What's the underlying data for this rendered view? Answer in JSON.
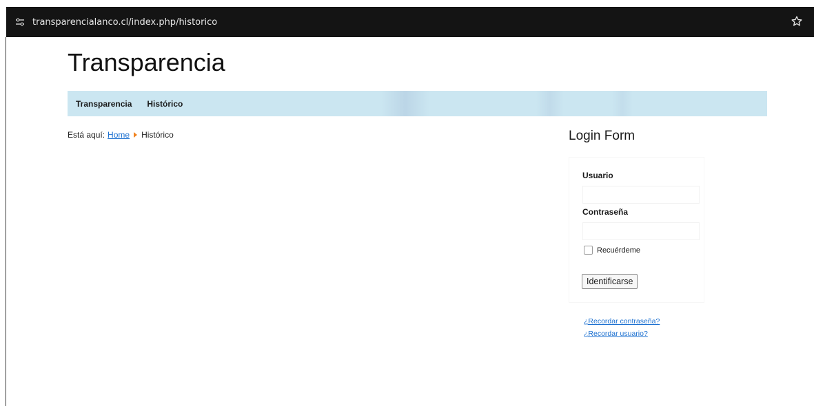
{
  "browser": {
    "url": "transparencialanco.cl/index.php/historico",
    "site_info_icon": "tune-icon",
    "bookmark_icon": "star-outline-icon"
  },
  "site": {
    "title": "Transparencia"
  },
  "nav": {
    "items": [
      {
        "label": "Transparencia"
      },
      {
        "label": "Histórico"
      }
    ]
  },
  "breadcrumb": {
    "prefix": "Está aquí:",
    "home": "Home",
    "current": "Histórico"
  },
  "login": {
    "title": "Login Form",
    "username_label": "Usuario",
    "password_label": "Contraseña",
    "remember_label": "Recuérdeme",
    "submit_label": "Identificarse",
    "forgot_password": "¿Recordar contraseña?",
    "forgot_username": "¿Recordar usuario?"
  },
  "colors": {
    "navbar_bg": "#cbe6f1",
    "link": "#1a6fd0",
    "breadcrumb_arrow": "#f0821e",
    "addressbar_bg": "#141414"
  }
}
